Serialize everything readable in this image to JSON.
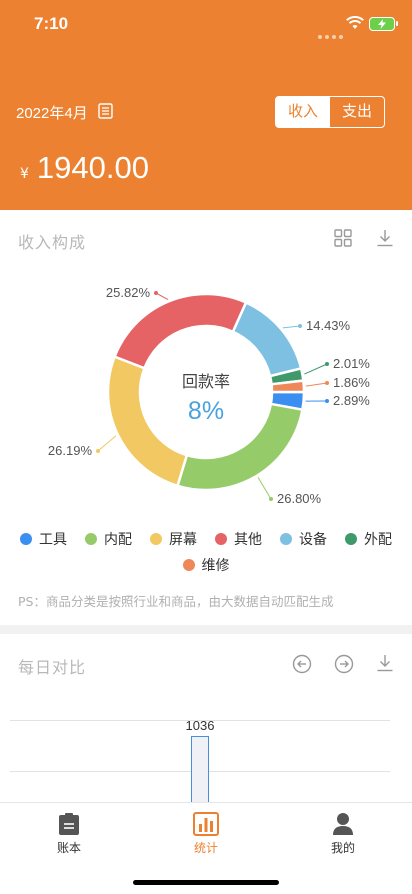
{
  "status_bar": {
    "time": "7:10"
  },
  "header": {
    "month": "2022年4月",
    "toggle": {
      "income": "收入",
      "expense": "支出",
      "selected": "收入"
    },
    "currency": "¥",
    "amount": "1940.00"
  },
  "composition": {
    "title": "收入构成",
    "center_label": "回款率",
    "center_value": "8%",
    "note": "PS：商品分类是按照行业和商品，由大数据自动匹配生成"
  },
  "chart_data": [
    {
      "type": "pie",
      "title": "",
      "series": [
        {
          "name": "工具",
          "value": 2.89,
          "label": "2.89%",
          "color": "#3b8ff0"
        },
        {
          "name": "内配",
          "value": 26.8,
          "label": "26.80%",
          "color": "#96cb6a"
        },
        {
          "name": "屏幕",
          "value": 26.19,
          "label": "26.19%",
          "color": "#f2c862"
        },
        {
          "name": "其他",
          "value": 25.82,
          "label": "25.82%",
          "color": "#e56364"
        },
        {
          "name": "设备",
          "value": 14.43,
          "label": "14.43%",
          "color": "#7ec0e2"
        },
        {
          "name": "外配",
          "value": 2.01,
          "label": "2.01%",
          "color": "#3f9a6b"
        },
        {
          "name": "维修",
          "value": 1.86,
          "label": "1.86%",
          "color": "#ee8858"
        }
      ]
    },
    {
      "type": "bar",
      "title": "每日对比",
      "categories": [
        ""
      ],
      "values": [
        1036
      ],
      "labels": [
        "1036"
      ]
    }
  ],
  "daily": {
    "title": "每日对比"
  },
  "tabs": [
    {
      "label": "账本",
      "icon": "ledger-icon"
    },
    {
      "label": "统计",
      "icon": "chart-icon"
    },
    {
      "label": "我的",
      "icon": "user-icon"
    }
  ],
  "colors": {
    "accent": "#ec8231"
  }
}
